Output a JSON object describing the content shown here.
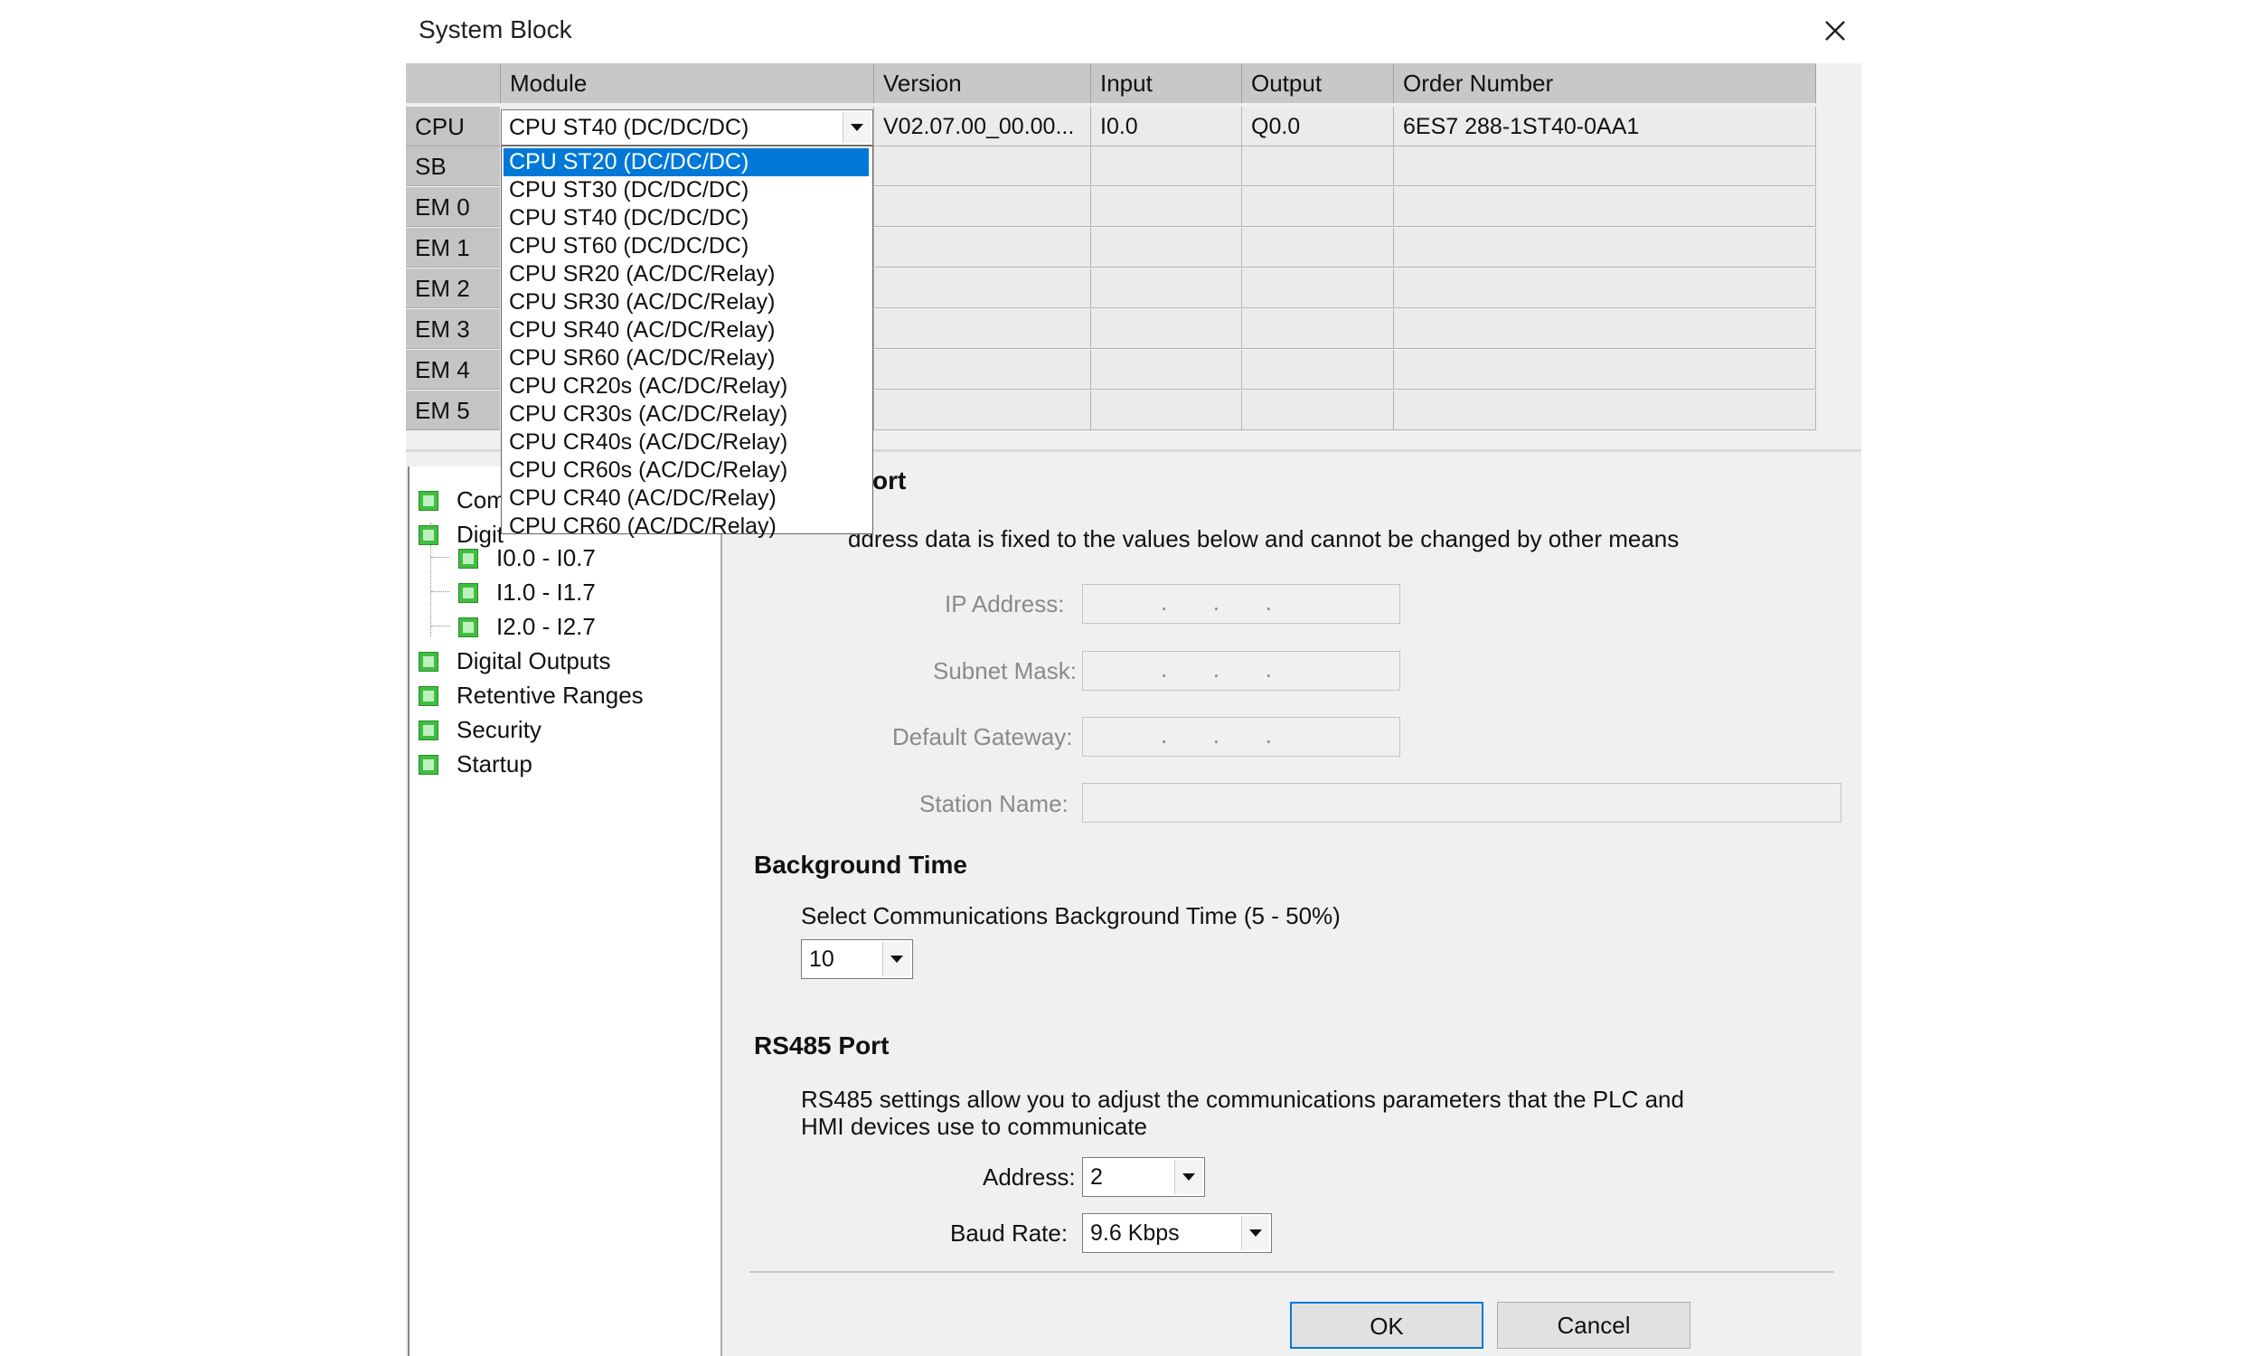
{
  "window": {
    "title": "System Block"
  },
  "grid": {
    "columns": [
      "Module",
      "Version",
      "Input",
      "Output",
      "Order Number"
    ],
    "rows": [
      {
        "slot": "CPU",
        "module": "CPU ST40 (DC/DC/DC)",
        "version": "V02.07.00_00.00...",
        "input": "I0.0",
        "output": "Q0.0",
        "order": "6ES7 288-1ST40-0AA1"
      },
      {
        "slot": "SB"
      },
      {
        "slot": "EM 0"
      },
      {
        "slot": "EM 1"
      },
      {
        "slot": "EM 2"
      },
      {
        "slot": "EM 3"
      },
      {
        "slot": "EM 4"
      },
      {
        "slot": "EM 5"
      }
    ]
  },
  "module_dropdown": {
    "selected_index": 0,
    "options": [
      "CPU ST20 (DC/DC/DC)",
      "CPU ST30 (DC/DC/DC)",
      "CPU ST40 (DC/DC/DC)",
      "CPU ST60 (DC/DC/DC)",
      "CPU SR20 (AC/DC/Relay)",
      "CPU SR30 (AC/DC/Relay)",
      "CPU SR40 (AC/DC/Relay)",
      "CPU SR60 (AC/DC/Relay)",
      "CPU CR20s (AC/DC/Relay)",
      "CPU CR30s (AC/DC/Relay)",
      "CPU CR40s (AC/DC/Relay)",
      "CPU CR60s (AC/DC/Relay)",
      "CPU CR40 (AC/DC/Relay)",
      "CPU CR60 (AC/DC/Relay)"
    ]
  },
  "tree": {
    "items": [
      {
        "label": "Comm",
        "level": 0
      },
      {
        "label": "Digit",
        "level": 0
      },
      {
        "label": "I0.0 - I0.7",
        "level": 1
      },
      {
        "label": "I1.0 - I1.7",
        "level": 1
      },
      {
        "label": "I2.0 - I2.7",
        "level": 1
      },
      {
        "label": "Digital Outputs",
        "level": 0
      },
      {
        "label": "Retentive Ranges",
        "level": 0
      },
      {
        "label": "Security",
        "level": 0
      },
      {
        "label": "Startup",
        "level": 0
      }
    ]
  },
  "ethernet": {
    "title_fragment": "ort",
    "fixed_text_fragment": "ddress data is fixed to the values below and cannot be changed by other means",
    "ip_label": "IP Address:",
    "subnet_label": "Subnet Mask:",
    "gateway_label": "Default Gateway:",
    "station_label": "Station Name:",
    "ip_dots": ".       .       ."
  },
  "background_time": {
    "title": "Background Time",
    "label": "Select Communications Background Time (5 - 50%)",
    "value": "10"
  },
  "rs485": {
    "title": "RS485 Port",
    "desc_line1": "RS485 settings allow you to adjust the communications parameters that the PLC and",
    "desc_line2": "HMI devices use to communicate",
    "address_label": "Address:",
    "address_value": "2",
    "baud_label": "Baud Rate:",
    "baud_value": "9.6 Kbps"
  },
  "buttons": {
    "ok": "OK",
    "cancel": "Cancel"
  }
}
